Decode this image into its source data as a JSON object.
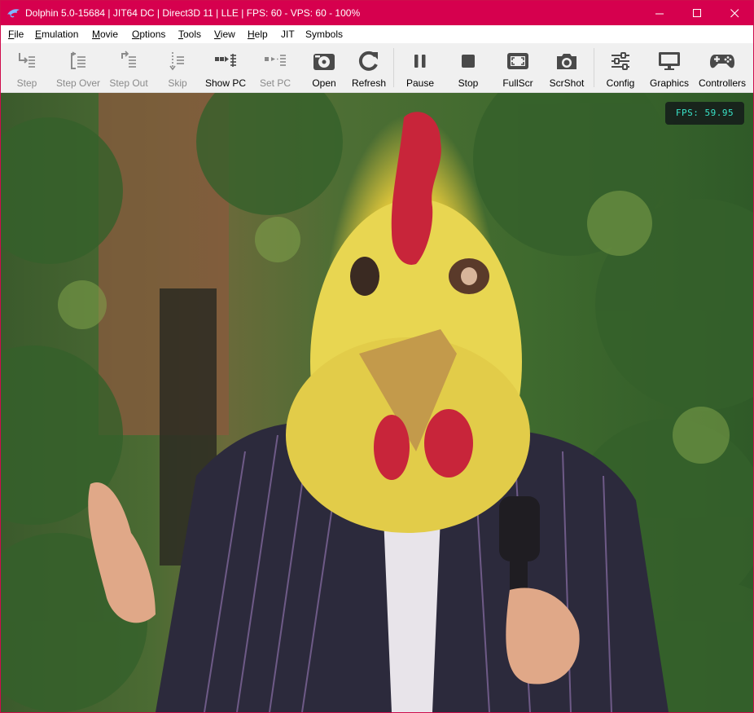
{
  "window": {
    "title": "Dolphin 5.0-15684 | JIT64 DC | Direct3D 11 | LLE | FPS: 60 - VPS: 60 - 100%",
    "accent_color": "#d6004e"
  },
  "menu": {
    "items": [
      {
        "label": "File",
        "accel": "F",
        "rest": "ile"
      },
      {
        "label": "Emulation",
        "accel": "E",
        "rest": "mulation"
      },
      {
        "label": "Movie",
        "accel": "M",
        "rest": "ovie"
      },
      {
        "label": "Options",
        "accel": "O",
        "rest": "ptions"
      },
      {
        "label": "Tools",
        "accel": "T",
        "rest": "ools"
      },
      {
        "label": "View",
        "accel": "V",
        "rest": "iew"
      },
      {
        "label": "Help",
        "accel": "H",
        "rest": "elp"
      },
      {
        "label": "JIT",
        "accel": "",
        "rest": "JIT"
      },
      {
        "label": "Symbols",
        "accel": "",
        "rest": "Symbols"
      }
    ]
  },
  "toolbar": {
    "step": "Step",
    "step_over": "Step Over",
    "step_out": "Step Out",
    "skip": "Skip",
    "show_pc": "Show PC",
    "set_pc": "Set PC",
    "open": "Open",
    "refresh": "Refresh",
    "pause": "Pause",
    "stop": "Stop",
    "fullscr": "FullScr",
    "scrshot": "ScrShot",
    "config": "Config",
    "graphics": "Graphics",
    "controllers": "Controllers"
  },
  "render": {
    "fps_overlay": "FPS: 59.95",
    "scene_colors": {
      "mask": "#e9d84f",
      "comb": "#c8253a",
      "foliage": "#3f6a2e",
      "suit": "#2c2a3c"
    }
  }
}
